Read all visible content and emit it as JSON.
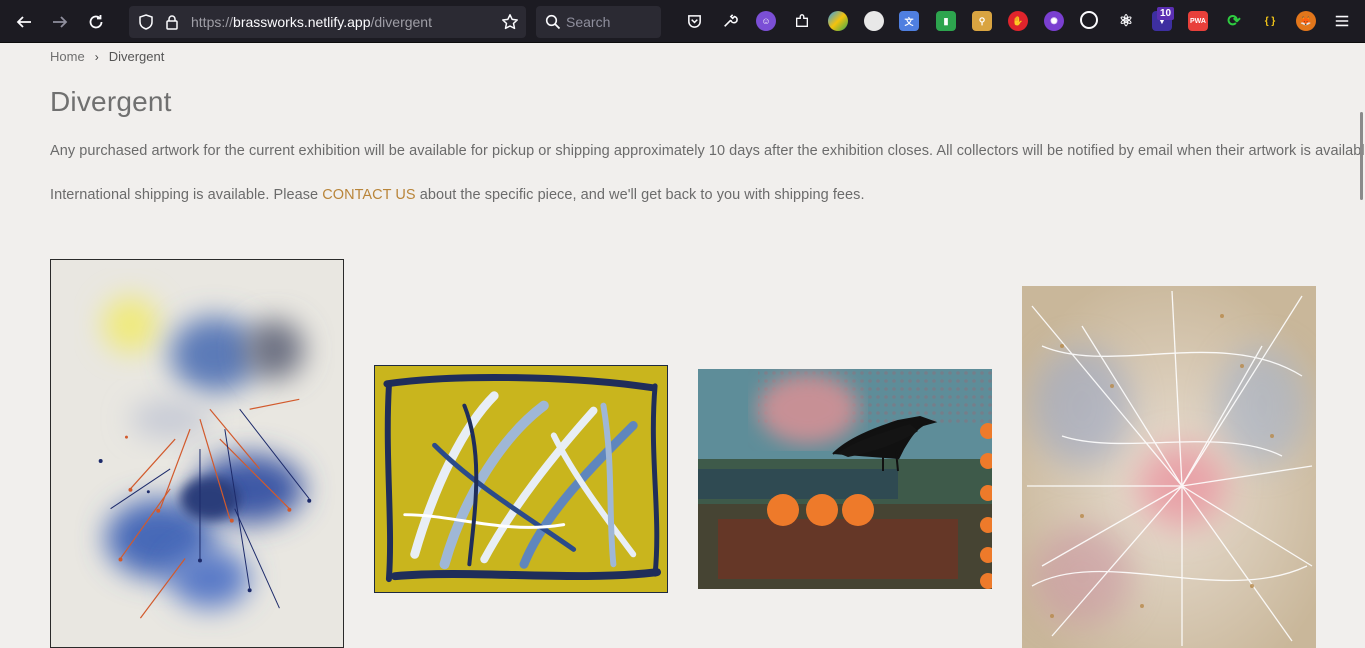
{
  "browser": {
    "url_prefix": "https://",
    "url_host": "brassworks.netlify.app",
    "url_path": "/divergent",
    "search_placeholder": "Search",
    "extension_badge": "10",
    "extension_icons": [
      "pocket-icon",
      "wrench-icon",
      "ghost-extension-icon",
      "puzzle-icon",
      "colorful-extension-icon",
      "cloud-extension-icon",
      "translate-extension-icon",
      "green-extension-icon",
      "broom-extension-icon",
      "red-hand-extension-icon",
      "gear-purple-extension-icon",
      "cookie-extension-icon",
      "react-icon",
      "counter-extension-icon",
      "pwa-extension-icon",
      "sync-extension-icon",
      "json-extension-icon",
      "fox-extension-icon",
      "menu-icon"
    ]
  },
  "breadcrumb": {
    "home": "Home",
    "separator": "›",
    "current": "Divergent"
  },
  "page": {
    "title": "Divergent",
    "paragraph1": "Any purchased artwork for the current exhibition will be available for pickup or shipping approximately 10 days after the exhibition closes. All collectors will be notified by email when their artwork is available.",
    "paragraph2_before": "International shipping is available. Please ",
    "paragraph2_link": "CONTACT US",
    "paragraph2_after": " about the specific piece, and we'll get back to you with shipping fees."
  },
  "colors": {
    "background": "#f1efed",
    "link": "#b9853a",
    "text": "#6b6b6b",
    "chrome": "#1c1b22"
  }
}
